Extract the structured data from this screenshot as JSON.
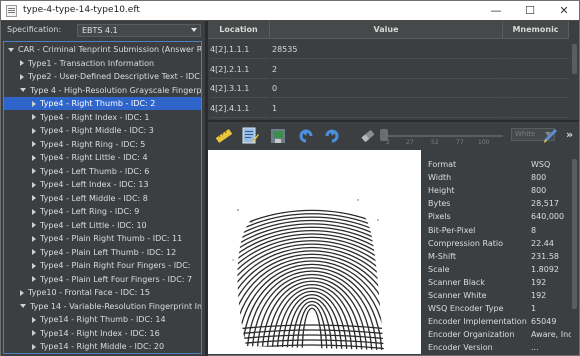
{
  "window": {
    "title": "type-4-type-14-type10.eft",
    "minimize": "—",
    "maximize": "☐",
    "close": "✕"
  },
  "spec": {
    "label": "Specification:",
    "value": "EBTS 4.1"
  },
  "tree": [
    {
      "label": "CAR - Criminal Tenprint Submission (Answer Requ",
      "expanded": true
    },
    {
      "label": "Type1 - Transaction Information",
      "expanded": false
    },
    {
      "label": "Type2 - User-Defined Descriptive Text - IDC: 0",
      "expanded": false
    },
    {
      "label": "Type 4 - High-Resolution Grayscale Fingerpr",
      "expanded": true
    },
    {
      "label": "Type4 - Right Thumb - IDC: 2",
      "selected": true
    },
    {
      "label": "Type4 - Right Index - IDC: 1"
    },
    {
      "label": "Type4 - Right Middle - IDC: 3"
    },
    {
      "label": "Type4 - Right Ring - IDC: 5"
    },
    {
      "label": "Type4 - Right Little - IDC: 4"
    },
    {
      "label": "Type4 - Left Thumb - IDC: 6"
    },
    {
      "label": "Type4 - Left Index - IDC: 13"
    },
    {
      "label": "Type4 - Left Middle - IDC: 8"
    },
    {
      "label": "Type4 - Left Ring - IDC: 9"
    },
    {
      "label": "Type4 - Left Little - IDC: 10"
    },
    {
      "label": "Type4 - Plain Right Thumb - IDC: 11"
    },
    {
      "label": "Type4 - Plain Left Thumb - IDC: 12"
    },
    {
      "label": "Type4 - Plain Right Four Fingers - IDC:"
    },
    {
      "label": "Type4 - Plain Left Four Fingers - IDC: 7"
    },
    {
      "label": "Type10 - Frontal Face - IDC: 15",
      "expanded": false
    },
    {
      "label": "Type 14 - Variable-Resolution Fingerprint Ima",
      "expanded": true
    },
    {
      "label": "Type14 - Right Thumb - IDC: 14"
    },
    {
      "label": "Type14 - Right Index - IDC: 16"
    },
    {
      "label": "Type14 - Right Middle - IDC: 20"
    }
  ],
  "table": {
    "headers": [
      "Location",
      "Value",
      "Mnemonic"
    ],
    "rows": [
      {
        "location": "4[2].1.1.1",
        "value": "28535",
        "mnemonic": ""
      },
      {
        "location": "4[2].2.1.1",
        "value": "2",
        "mnemonic": ""
      },
      {
        "location": "4[2].3.1.1",
        "value": "0",
        "mnemonic": ""
      },
      {
        "location": "4[2].4.1.1",
        "value": "1",
        "mnemonic": ""
      }
    ]
  },
  "toolbar": {
    "icons": [
      "ruler-icon",
      "edit-document-icon",
      "image-save-icon",
      "rotate-left-icon",
      "rotate-right-icon",
      "eraser-icon",
      "pen-icon"
    ],
    "zoom_ticks": [
      "2",
      "27",
      "52",
      "77",
      "100"
    ],
    "background_select": "White",
    "more": "»"
  },
  "properties": [
    {
      "key": "Format",
      "value": "WSQ"
    },
    {
      "key": "Width",
      "value": "800"
    },
    {
      "key": "Height",
      "value": "800"
    },
    {
      "key": "Bytes",
      "value": "28,517"
    },
    {
      "key": "Pixels",
      "value": "640,000"
    },
    {
      "key": "Bit-Per-Pixel",
      "value": "8"
    },
    {
      "key": "Compression Ratio",
      "value": "22.44"
    },
    {
      "key": "M-Shift",
      "value": "231.58"
    },
    {
      "key": "Scale",
      "value": "1.8092"
    },
    {
      "key": "Scanner Black",
      "value": "192"
    },
    {
      "key": "Scanner White",
      "value": "192"
    },
    {
      "key": "WSQ Encoder Type",
      "value": "1"
    },
    {
      "key": "Encoder Implementation",
      "value": "65049"
    },
    {
      "key": "Encoder Organization",
      "value": "Aware, Inc"
    },
    {
      "key": "Encoder Version",
      "value": "..."
    }
  ],
  "colors": {
    "panel": "#3c3f41",
    "selection": "#2f65ca",
    "tree_border": "#4c7fbe"
  }
}
